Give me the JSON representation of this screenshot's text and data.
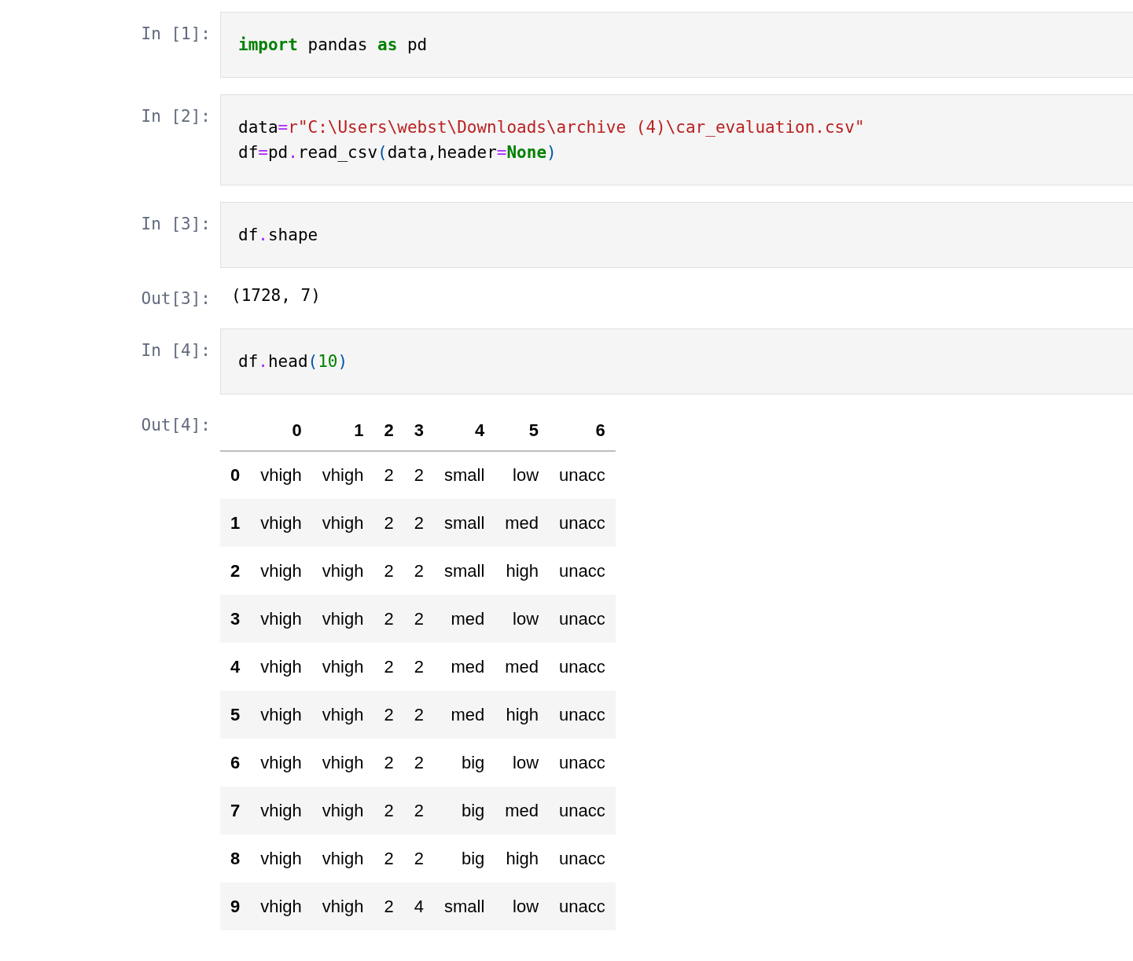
{
  "cells": [
    {
      "kind": "input",
      "prompt": "In [1]:",
      "lines": [
        [
          {
            "kind": "keyword",
            "text": "import"
          },
          {
            "kind": "name",
            "text": " pandas "
          },
          {
            "kind": "keyword",
            "text": "as"
          },
          {
            "kind": "name",
            "text": " pd"
          }
        ]
      ]
    },
    {
      "kind": "input",
      "prompt": "In [2]:",
      "lines": [
        [
          {
            "kind": "name",
            "text": "data"
          },
          {
            "kind": "operator",
            "text": "="
          },
          {
            "kind": "string",
            "text": "r\"C:\\Users\\webst\\Downloads\\archive (4)\\car_evaluation.csv\""
          }
        ],
        [
          {
            "kind": "name",
            "text": "df"
          },
          {
            "kind": "operator",
            "text": "="
          },
          {
            "kind": "name",
            "text": "pd"
          },
          {
            "kind": "operator",
            "text": "."
          },
          {
            "kind": "name",
            "text": "read_csv"
          },
          {
            "kind": "punct",
            "text": "("
          },
          {
            "kind": "name",
            "text": "data"
          },
          {
            "kind": "name",
            "text": ","
          },
          {
            "kind": "name",
            "text": "header"
          },
          {
            "kind": "operator",
            "text": "="
          },
          {
            "kind": "keyword",
            "text": "None"
          },
          {
            "kind": "punct",
            "text": ")"
          }
        ]
      ]
    },
    {
      "kind": "input",
      "prompt": "In [3]:",
      "lines": [
        [
          {
            "kind": "name",
            "text": "df"
          },
          {
            "kind": "operator",
            "text": "."
          },
          {
            "kind": "name",
            "text": "shape"
          }
        ]
      ]
    },
    {
      "kind": "text_output",
      "prompt": "Out[3]:",
      "text": "(1728, 7)"
    },
    {
      "kind": "input",
      "prompt": "In [4]:",
      "lines": [
        [
          {
            "kind": "name",
            "text": "df"
          },
          {
            "kind": "operator",
            "text": "."
          },
          {
            "kind": "name",
            "text": "head"
          },
          {
            "kind": "punct",
            "text": "("
          },
          {
            "kind": "number",
            "text": "10"
          },
          {
            "kind": "punct",
            "text": ")"
          }
        ]
      ]
    },
    {
      "kind": "table_output",
      "prompt": "Out[4]:",
      "table": {
        "columns": [
          "0",
          "1",
          "2",
          "3",
          "4",
          "5",
          "6"
        ],
        "rows": [
          {
            "index": "0",
            "cells": [
              "vhigh",
              "vhigh",
              "2",
              "2",
              "small",
              "low",
              "unacc"
            ]
          },
          {
            "index": "1",
            "cells": [
              "vhigh",
              "vhigh",
              "2",
              "2",
              "small",
              "med",
              "unacc"
            ]
          },
          {
            "index": "2",
            "cells": [
              "vhigh",
              "vhigh",
              "2",
              "2",
              "small",
              "high",
              "unacc"
            ]
          },
          {
            "index": "3",
            "cells": [
              "vhigh",
              "vhigh",
              "2",
              "2",
              "med",
              "low",
              "unacc"
            ]
          },
          {
            "index": "4",
            "cells": [
              "vhigh",
              "vhigh",
              "2",
              "2",
              "med",
              "med",
              "unacc"
            ]
          },
          {
            "index": "5",
            "cells": [
              "vhigh",
              "vhigh",
              "2",
              "2",
              "med",
              "high",
              "unacc"
            ]
          },
          {
            "index": "6",
            "cells": [
              "vhigh",
              "vhigh",
              "2",
              "2",
              "big",
              "low",
              "unacc"
            ]
          },
          {
            "index": "7",
            "cells": [
              "vhigh",
              "vhigh",
              "2",
              "2",
              "big",
              "med",
              "unacc"
            ]
          },
          {
            "index": "8",
            "cells": [
              "vhigh",
              "vhigh",
              "2",
              "2",
              "big",
              "high",
              "unacc"
            ]
          },
          {
            "index": "9",
            "cells": [
              "vhigh",
              "vhigh",
              "2",
              "4",
              "small",
              "low",
              "unacc"
            ]
          }
        ]
      }
    }
  ]
}
